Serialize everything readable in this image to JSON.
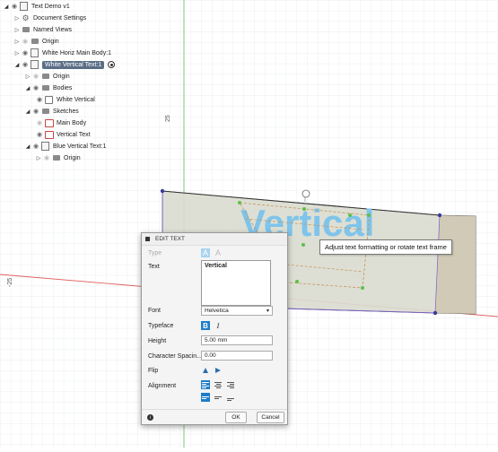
{
  "browser": {
    "items": [
      {
        "label": "Text Demo v1",
        "icon": "document-icon"
      },
      {
        "label": "Document Settings",
        "icon": "gear-icon"
      },
      {
        "label": "Named Views",
        "icon": "folder-icon"
      },
      {
        "label": "Origin",
        "icon": "folder-icon"
      },
      {
        "label": "White Horiz Main Body:1",
        "icon": "component-icon"
      },
      {
        "label": "White Vertical Text:1",
        "icon": "component-icon",
        "active": true
      },
      {
        "label": "Origin",
        "icon": "folder-icon"
      },
      {
        "label": "Bodies",
        "icon": "folder-icon"
      },
      {
        "label": "White Vertical",
        "icon": "body-icon"
      },
      {
        "label": "Sketches",
        "icon": "folder-icon"
      },
      {
        "label": "Main Body",
        "icon": "sketch-icon"
      },
      {
        "label": "Vertical Text",
        "icon": "sketch-icon"
      },
      {
        "label": "Blue Vertical Text:1",
        "icon": "component-icon"
      },
      {
        "label": "Origin",
        "icon": "folder-icon"
      }
    ]
  },
  "viewport": {
    "axis_label_top": "25",
    "axis_label_left": "-25",
    "model_text": "Vertical",
    "colors": {
      "grid": "#e3e7ea",
      "axis_red": "#e06060",
      "axis_green": "#70c070",
      "model_fill": "#d9dccf",
      "model_edge": "#7a5fc0",
      "text_blue": "#7fc4ea"
    }
  },
  "tooltip": "Adjust text formatting or rotate text frame",
  "dialog": {
    "title": "EDIT TEXT",
    "type_label": "Type",
    "text_label": "Text",
    "text_value": "Vertical",
    "font_label": "Font",
    "font_value": "Helvetica",
    "typeface_label": "Typeface",
    "bold_glyph": "B",
    "italic_glyph": "I",
    "height_label": "Height",
    "height_value": "5.00 mm",
    "spacing_label": "Character Spacin...",
    "spacing_value": "0.00",
    "flip_label": "Flip",
    "alignment_label": "Alignment",
    "ok_label": "OK",
    "cancel_label": "Cancel",
    "accent": "#1e7dc8"
  }
}
